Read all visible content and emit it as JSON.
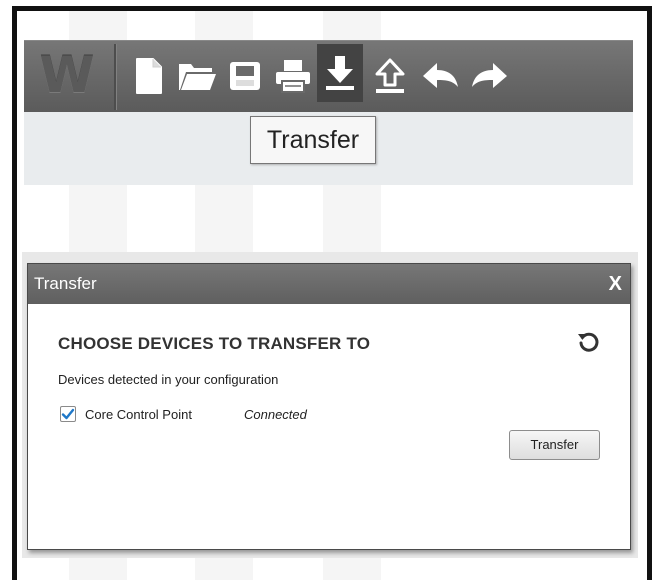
{
  "toolbar": {
    "logo_text": "W",
    "buttons": [
      {
        "name": "new",
        "icon": "new-file-icon"
      },
      {
        "name": "open",
        "icon": "folder-open-icon"
      },
      {
        "name": "save",
        "icon": "save-icon"
      },
      {
        "name": "print",
        "icon": "printer-icon"
      },
      {
        "name": "transfer",
        "icon": "download-arrow-icon",
        "active": true
      },
      {
        "name": "upload",
        "icon": "upload-arrow-icon"
      },
      {
        "name": "undo",
        "icon": "undo-arrow-icon"
      },
      {
        "name": "redo",
        "icon": "redo-arrow-icon"
      }
    ]
  },
  "tooltip": {
    "text": "Transfer"
  },
  "dialog": {
    "title": "Transfer",
    "close_label": "X",
    "heading": "CHOOSE DEVICES TO TRANSFER TO",
    "subtext": "Devices detected in your configuration",
    "devices": [
      {
        "name": "Core Control Point",
        "status": "Connected",
        "checked": true
      }
    ],
    "transfer_button_label": "Transfer",
    "refresh_icon": "refresh-icon"
  },
  "colors": {
    "toolbar_bg": "#6a6a6a",
    "active_button_bg": "#434343",
    "band_bg": "#e9ecee",
    "checkbox_check": "#1f78c8"
  }
}
